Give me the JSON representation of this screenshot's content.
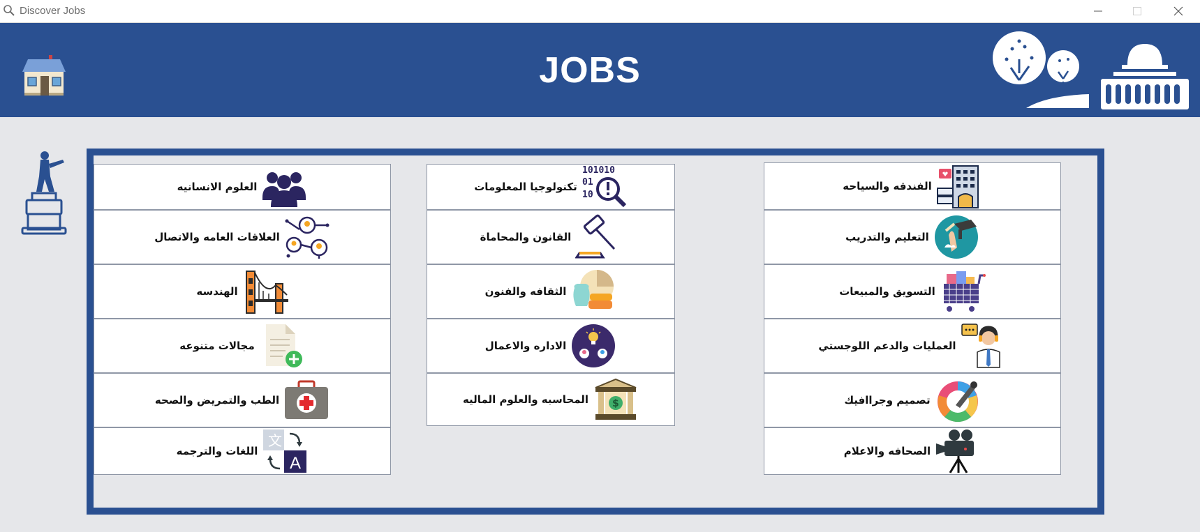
{
  "window": {
    "title": "Discover Jobs",
    "search_icon": "magnifier-icon",
    "controls": [
      "minimize",
      "maximize",
      "close"
    ]
  },
  "header": {
    "title": "JOBS",
    "background": "#2a5091",
    "left_icon": "house-icon",
    "right_icons": [
      "trees-icon",
      "dome-of-the-rock-icon"
    ]
  },
  "side_icon": "statue-icon",
  "categories": {
    "col_right": [
      {
        "label": "الفندقه والسياحه",
        "icon": "hotel-icon"
      },
      {
        "label": "التعليم والتدريب",
        "icon": "graduation-icon"
      },
      {
        "label": "التسويق والمبيعات",
        "icon": "shopping-cart-icon"
      },
      {
        "label": "العمليات والدعم اللوجستي",
        "icon": "support-agent-icon"
      },
      {
        "label": "تصميم وجراافيك",
        "icon": "color-wheel-icon"
      },
      {
        "label": "الصحافه والاعلام",
        "icon": "video-camera-icon"
      }
    ],
    "col_middle": [
      {
        "label": "تكنولوجيا المعلومات",
        "icon": "binary-search-icon"
      },
      {
        "label": "القانون والمحاماة",
        "icon": "gavel-icon"
      },
      {
        "label": "الثقافه والفنون",
        "icon": "pottery-icon"
      },
      {
        "label": "الاداره والاعمال",
        "icon": "business-idea-icon"
      },
      {
        "label": "المحاسبه والعلوم الماليه",
        "icon": "bank-icon"
      }
    ],
    "col_left": [
      {
        "label": "العلوم الانسانيه",
        "icon": "people-group-icon"
      },
      {
        "label": "العلاقات العامه والاتصال",
        "icon": "network-people-icon"
      },
      {
        "label": "الهندسه",
        "icon": "bridge-icon"
      },
      {
        "label": "مجالات متنوعه",
        "icon": "add-document-icon"
      },
      {
        "label": "الطب والتمريض والصحه",
        "icon": "first-aid-kit-icon"
      },
      {
        "label": "اللغات والترجمه",
        "icon": "translate-icon"
      }
    ]
  }
}
